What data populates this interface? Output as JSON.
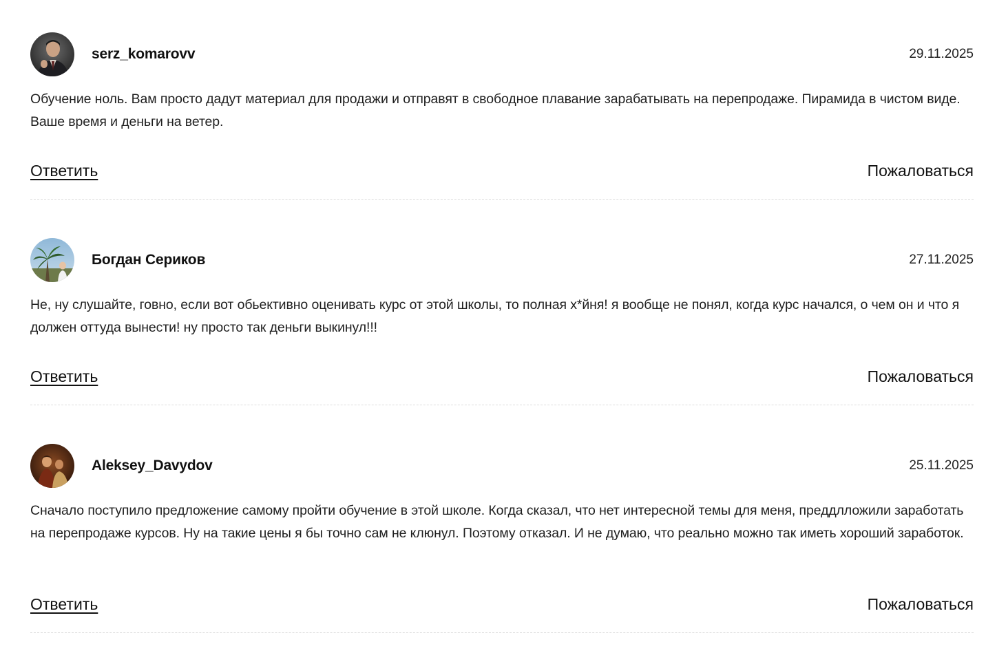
{
  "comments": [
    {
      "author": "serz_komarovv",
      "date": "29.11.2025",
      "text": "Обучение ноль. Вам просто дадут материал для продажи и отправят в свободное плавание зарабатывать на перепродаже. Пирамида в чистом виде. Ваше время и деньги на ветер.",
      "reply_label": "Ответить",
      "report_label": "Пожаловаться",
      "avatar_icon": "person-photo-avatar"
    },
    {
      "author": "Богдан Сериков",
      "date": "27.11.2025",
      "text": "Не, ну слушайте, говно, если вот обьективно оценивать курс от этой школы, то полная х*йня! я вообще не понял, когда курс начался, о чем он и что я должен оттуда вынести! ну просто так деньги выкинул!!!",
      "reply_label": "Ответить",
      "report_label": "Пожаловаться",
      "avatar_icon": "palm-tree-photo-avatar"
    },
    {
      "author": "Aleksey_Davydov",
      "date": "25.11.2025",
      "text": "Сначало поступило предложение самому пройти обучение в этой школе. Когда сказал, что нет интересной темы для меня, преддлложили заработать на перепродаже курсов. Ну на такие цены я бы точно сам не клюнул. Поэтому отказал. И не думаю, что реально можно так иметь хороший заработок.",
      "reply_label": "Ответить",
      "report_label": "Пожаловаться",
      "avatar_icon": "painting-photo-avatar"
    }
  ]
}
